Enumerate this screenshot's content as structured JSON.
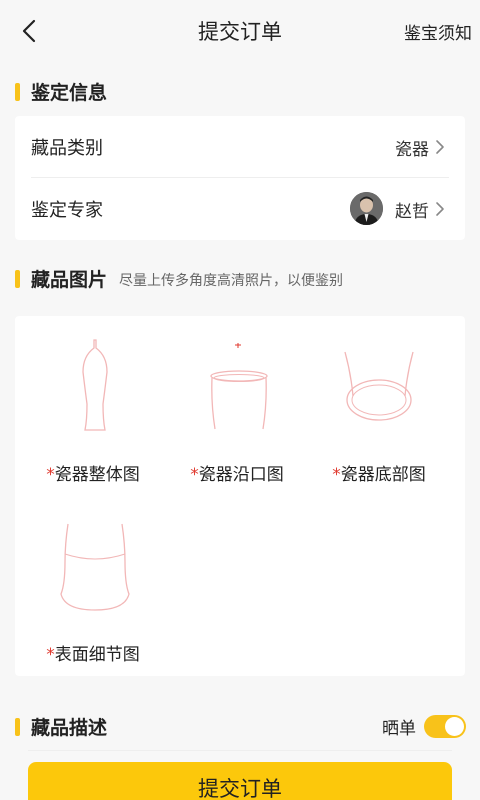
{
  "nav": {
    "title": "提交订单",
    "right_link": "鉴宝须知"
  },
  "appraisal_info": {
    "title": "鉴定信息",
    "category_label": "藏品类别",
    "category_value": "瓷器",
    "expert_label": "鉴定专家",
    "expert_name": "赵哲"
  },
  "photos": {
    "title": "藏品图片",
    "hint": "尽量上传多角度高清照片，以便鉴别",
    "required_mark": "*",
    "slots": [
      {
        "label": "瓷器整体图",
        "icon": "vase-outline-icon"
      },
      {
        "label": "瓷器沿口图",
        "icon": "vase-rim-icon"
      },
      {
        "label": "瓷器底部图",
        "icon": "vase-bottom-icon"
      },
      {
        "label": "表面细节图",
        "icon": "surface-detail-icon"
      }
    ]
  },
  "description": {
    "title": "藏品描述",
    "toggle_label": "晒单",
    "toggle_on": true
  },
  "submit": {
    "label": "提交订单"
  },
  "colors": {
    "accent": "#f8c21a",
    "required": "#e0392f",
    "sketch": "#f2b7b7"
  }
}
